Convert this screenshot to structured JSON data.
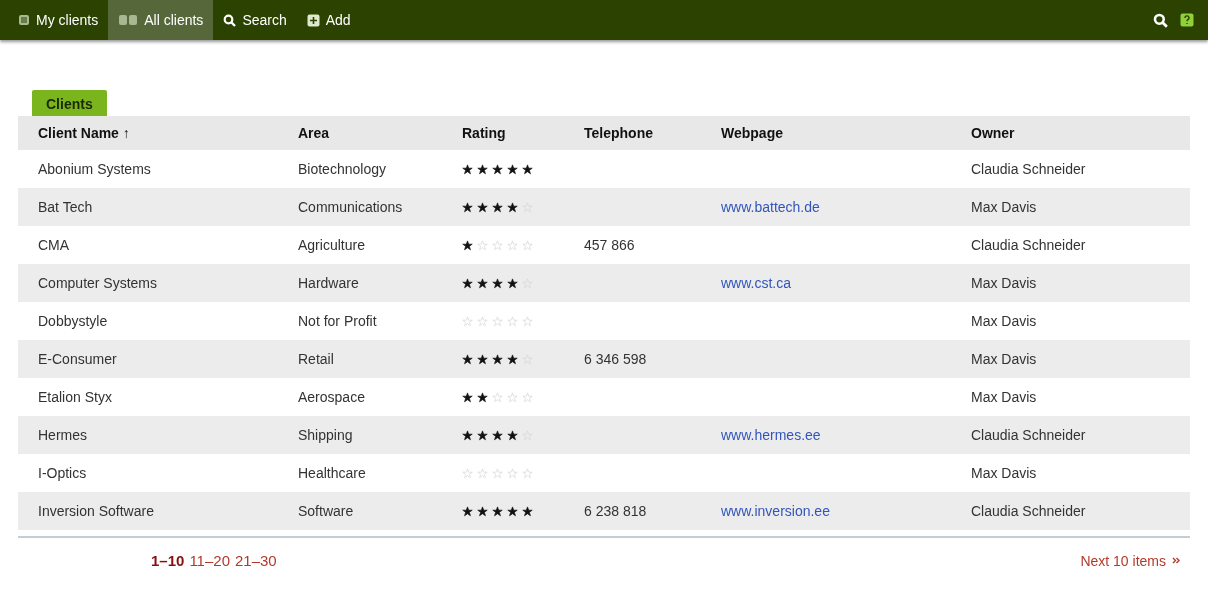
{
  "nav": {
    "items": [
      {
        "kind": "my",
        "label": "My clients",
        "selected": false
      },
      {
        "kind": "all",
        "label": "All clients",
        "selected": true
      },
      {
        "kind": "search",
        "label": "Search",
        "selected": false
      },
      {
        "kind": "add",
        "label": "Add",
        "selected": false
      }
    ]
  },
  "tab": {
    "label": "Clients"
  },
  "table": {
    "columns": [
      "Client Name ↑",
      "Area",
      "Rating",
      "Telephone",
      "Webpage",
      "Owner"
    ],
    "rows": [
      {
        "name": "Abonium Systems",
        "area": "Biotechnology",
        "stars": 5,
        "owner": "Claudia Schneider"
      },
      {
        "name": "Bat Tech",
        "area": "Communications",
        "stars": 4,
        "webpage": "www.battech.de",
        "owner": "Max Davis"
      },
      {
        "name": "CMA",
        "area": "Agriculture",
        "stars": 1,
        "telephone": "457 866",
        "owner": "Claudia Schneider"
      },
      {
        "name": "Computer Systems",
        "area": "Hardware",
        "stars": 4,
        "webpage": "www.cst.ca",
        "owner": "Max Davis"
      },
      {
        "name": "Dobbystyle",
        "area": "Not for Profit",
        "stars": 0,
        "owner": "Max Davis"
      },
      {
        "name": "E-Consumer",
        "area": "Retail",
        "stars": 4,
        "telephone": "6 346 598",
        "owner": "Max Davis"
      },
      {
        "name": "Etalion Styx",
        "area": "Aerospace",
        "stars": 2,
        "owner": "Max Davis"
      },
      {
        "name": "Hermes",
        "area": "Shipping",
        "stars": 4,
        "webpage": "www.hermes.ee",
        "owner": "Claudia Schneider"
      },
      {
        "name": "I-Optics",
        "area": "Healthcare",
        "stars": 0,
        "owner": "Max Davis"
      },
      {
        "name": "Inversion Software",
        "area": "Software",
        "stars": 5,
        "telephone": "6 238 818",
        "webpage": "www.inversion.ee",
        "owner": "Claudia Schneider"
      }
    ]
  },
  "pagination": {
    "pages": [
      {
        "label": "1–10",
        "selected": true
      },
      {
        "label": "11–20",
        "selected": false
      },
      {
        "label": "21–30",
        "selected": false
      }
    ],
    "next": "Next 10 items"
  }
}
